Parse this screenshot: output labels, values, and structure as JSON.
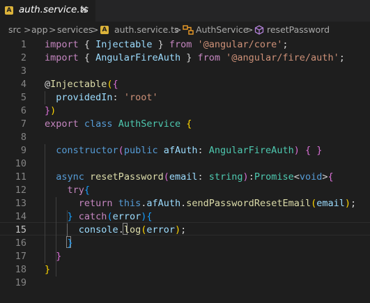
{
  "tab": {
    "icon": "angular-icon",
    "icon_glyph": "A",
    "filename": "auth.service.ts",
    "close_glyph": "✕"
  },
  "breadcrumb": {
    "segments": [
      "src",
      "app",
      "services",
      "auth.service.ts",
      "AuthService",
      "resetPassword"
    ],
    "separator": ">",
    "icons": {
      "file": "angular-icon",
      "class": "class-icon",
      "method": "method-icon"
    }
  },
  "editor": {
    "active_line": 15,
    "line_numbers": [
      "1",
      "2",
      "3",
      "4",
      "5",
      "6",
      "7",
      "8",
      "9",
      "10",
      "11",
      "12",
      "13",
      "14",
      "15",
      "16",
      "17",
      "18",
      "19"
    ],
    "lines": [
      [
        {
          "t": "import",
          "c": "ctl"
        },
        {
          "t": " { ",
          "c": "pun"
        },
        {
          "t": "Injectable",
          "c": "var"
        },
        {
          "t": " } ",
          "c": "pun"
        },
        {
          "t": "from",
          "c": "ctl"
        },
        {
          "t": " ",
          "c": "pun"
        },
        {
          "t": "'@angular/core'",
          "c": "str"
        },
        {
          "t": ";",
          "c": "pun"
        }
      ],
      [
        {
          "t": "import",
          "c": "ctl"
        },
        {
          "t": " { ",
          "c": "pun"
        },
        {
          "t": "AngularFireAuth",
          "c": "var"
        },
        {
          "t": " } ",
          "c": "pun"
        },
        {
          "t": "from",
          "c": "ctl"
        },
        {
          "t": " ",
          "c": "pun"
        },
        {
          "t": "'@angular/fire/auth'",
          "c": "str"
        },
        {
          "t": ";",
          "c": "pun"
        }
      ],
      [],
      [
        {
          "t": "@",
          "c": "pun"
        },
        {
          "t": "Injectable",
          "c": "fn"
        },
        {
          "t": "(",
          "c": "br1"
        },
        {
          "t": "{",
          "c": "br2"
        }
      ],
      [
        {
          "t": "  ",
          "c": "pun"
        },
        {
          "t": "providedIn",
          "c": "var"
        },
        {
          "t": ": ",
          "c": "pun"
        },
        {
          "t": "'root'",
          "c": "str"
        }
      ],
      [
        {
          "t": "}",
          "c": "br2"
        },
        {
          "t": ")",
          "c": "br1"
        }
      ],
      [
        {
          "t": "export",
          "c": "ctl"
        },
        {
          "t": " ",
          "c": "pun"
        },
        {
          "t": "class",
          "c": "kw"
        },
        {
          "t": " ",
          "c": "pun"
        },
        {
          "t": "AuthService",
          "c": "cls"
        },
        {
          "t": " ",
          "c": "pun"
        },
        {
          "t": "{",
          "c": "br1"
        }
      ],
      [],
      [
        {
          "t": "  ",
          "c": "pun"
        },
        {
          "t": "constructor",
          "c": "kw"
        },
        {
          "t": "(",
          "c": "br2"
        },
        {
          "t": "public",
          "c": "kw"
        },
        {
          "t": " ",
          "c": "pun"
        },
        {
          "t": "afAuth",
          "c": "var"
        },
        {
          "t": ": ",
          "c": "pun"
        },
        {
          "t": "AngularFireAuth",
          "c": "cls"
        },
        {
          "t": ")",
          "c": "br2"
        },
        {
          "t": " ",
          "c": "pun"
        },
        {
          "t": "{",
          "c": "br2"
        },
        {
          "t": " ",
          "c": "pun"
        },
        {
          "t": "}",
          "c": "br2"
        }
      ],
      [],
      [
        {
          "t": "  ",
          "c": "pun"
        },
        {
          "t": "async",
          "c": "kw"
        },
        {
          "t": " ",
          "c": "pun"
        },
        {
          "t": "resetPassword",
          "c": "fn"
        },
        {
          "t": "(",
          "c": "br2"
        },
        {
          "t": "email",
          "c": "var"
        },
        {
          "t": ": ",
          "c": "pun"
        },
        {
          "t": "string",
          "c": "cls"
        },
        {
          "t": ")",
          "c": "br2"
        },
        {
          "t": ":",
          "c": "pun"
        },
        {
          "t": "Promise",
          "c": "cls"
        },
        {
          "t": "<",
          "c": "pun"
        },
        {
          "t": "void",
          "c": "kw"
        },
        {
          "t": ">",
          "c": "pun"
        },
        {
          "t": "{",
          "c": "br2"
        }
      ],
      [
        {
          "t": "    ",
          "c": "pun"
        },
        {
          "t": "try",
          "c": "ctl"
        },
        {
          "t": "{",
          "c": "br3"
        }
      ],
      [
        {
          "t": "      ",
          "c": "pun"
        },
        {
          "t": "return",
          "c": "ctl"
        },
        {
          "t": " ",
          "c": "pun"
        },
        {
          "t": "this",
          "c": "kw"
        },
        {
          "t": ".",
          "c": "pun"
        },
        {
          "t": "afAuth",
          "c": "var"
        },
        {
          "t": ".",
          "c": "pun"
        },
        {
          "t": "sendPasswordResetEmail",
          "c": "fn"
        },
        {
          "t": "(",
          "c": "br1"
        },
        {
          "t": "email",
          "c": "var"
        },
        {
          "t": ")",
          "c": "br1"
        },
        {
          "t": ";",
          "c": "pun"
        }
      ],
      [
        {
          "t": "    ",
          "c": "pun"
        },
        {
          "t": "}",
          "c": "br3"
        },
        {
          "t": " ",
          "c": "pun"
        },
        {
          "t": "catch",
          "c": "ctl"
        },
        {
          "t": "(",
          "c": "br3"
        },
        {
          "t": "error",
          "c": "var"
        },
        {
          "t": ")",
          "c": "br3"
        },
        {
          "t": "{",
          "c": "br3"
        }
      ],
      [
        {
          "t": "      ",
          "c": "pun"
        },
        {
          "t": "console",
          "c": "var"
        },
        {
          "t": ".",
          "c": "pun"
        },
        {
          "t": "log",
          "c": "fn"
        },
        {
          "t": "(",
          "c": "br1"
        },
        {
          "t": "error",
          "c": "var"
        },
        {
          "t": ")",
          "c": "br1"
        },
        {
          "t": ";",
          "c": "pun"
        }
      ],
      [
        {
          "t": "    ",
          "c": "pun"
        },
        {
          "t": "}",
          "c": "br3"
        }
      ],
      [
        {
          "t": "  ",
          "c": "pun"
        },
        {
          "t": "}",
          "c": "br2"
        }
      ],
      [
        {
          "t": "}",
          "c": "br1"
        }
      ],
      []
    ]
  },
  "colors": {
    "editor_bg": "#1e1e1e",
    "tabbar_bg": "#252526",
    "line_number": "#858585",
    "keyword": "#569cd6",
    "control": "#c586c0",
    "string": "#ce9178",
    "type": "#4ec9b0",
    "function": "#dcdcaa",
    "variable": "#9cdcfe",
    "angular_icon": "#dcb33a",
    "symbol_class": "#ee9d28",
    "symbol_method": "#b180d7"
  }
}
